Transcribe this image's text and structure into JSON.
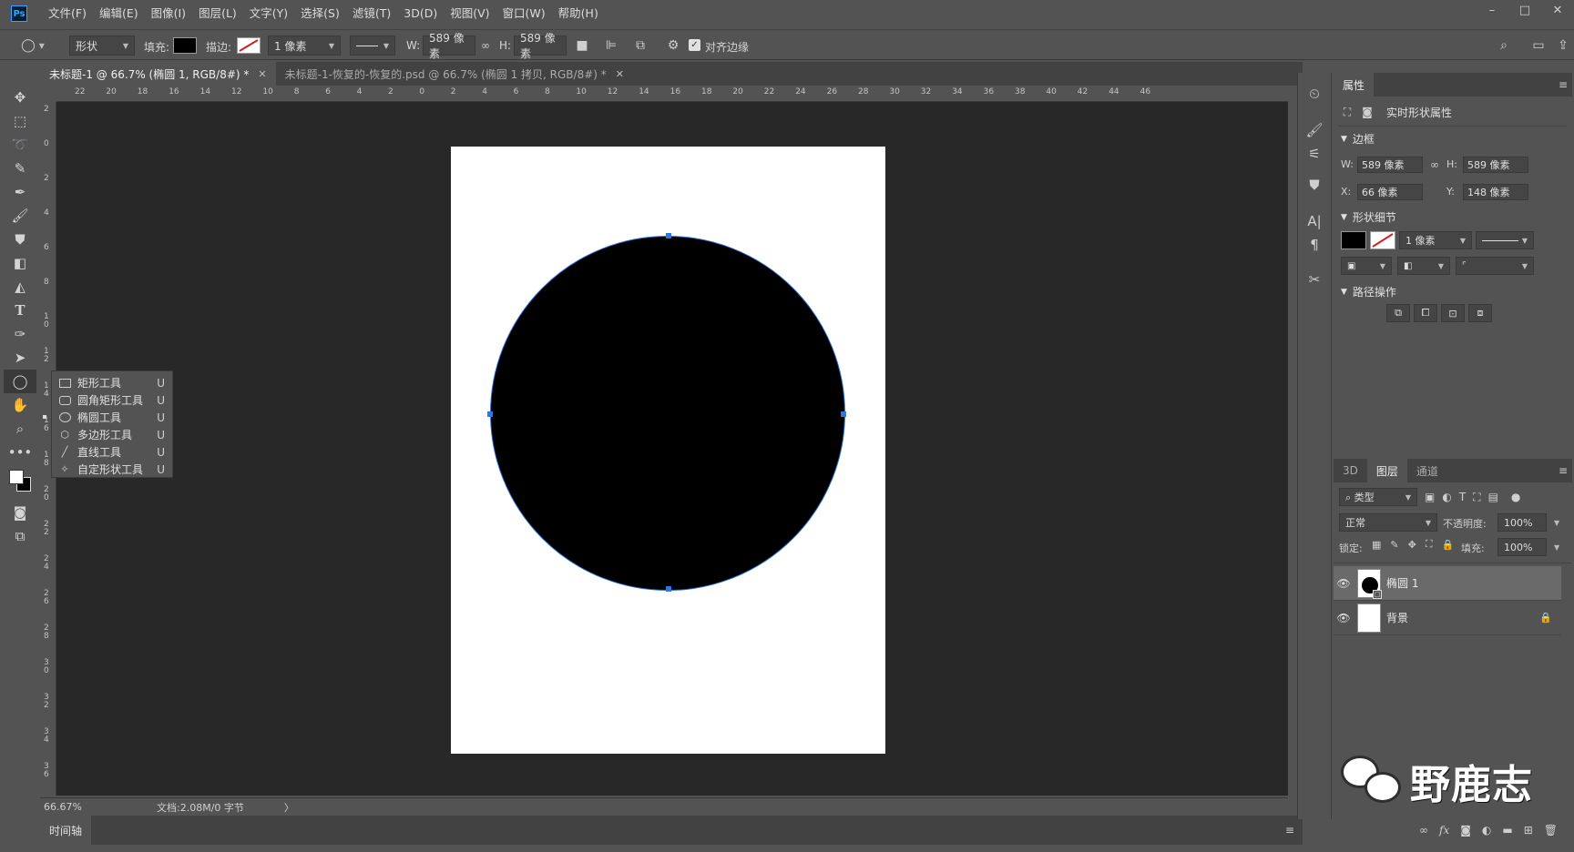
{
  "app": {
    "logo": "Ps"
  },
  "menu": [
    "文件(F)",
    "编辑(E)",
    "图像(I)",
    "图层(L)",
    "文字(Y)",
    "选择(S)",
    "滤镜(T)",
    "3D(D)",
    "视图(V)",
    "窗口(W)",
    "帮助(H)"
  ],
  "window_controls": {
    "minimize": "–",
    "maximize": "□",
    "close": "✕"
  },
  "options": {
    "mode": "形状",
    "fill_label": "填充:",
    "stroke_label": "描边:",
    "stroke_width": "1 像素",
    "w_label": "W:",
    "w_value": "589 像素",
    "h_label": "H:",
    "h_value": "589 像素",
    "align_edges": "对齐边缘"
  },
  "tabs": [
    {
      "label": "未标题-1 @ 66.7% (椭圆 1, RGB/8#) *",
      "active": true
    },
    {
      "label": "未标题-1-恢复的-恢复的.psd @ 66.7% (椭圆 1 拷贝, RGB/8#) *",
      "active": false
    }
  ],
  "tab_close": "✕",
  "ruler_top": [
    "22",
    "20",
    "18",
    "16",
    "14",
    "12",
    "10",
    "8",
    "6",
    "4",
    "2",
    "0",
    "2",
    "4",
    "6",
    "8",
    "10",
    "12",
    "14",
    "16",
    "18",
    "20",
    "22",
    "24",
    "26",
    "28",
    "30",
    "32",
    "34",
    "36",
    "38",
    "40",
    "42",
    "44",
    "46"
  ],
  "ruler_left": [
    "2",
    "0",
    "2",
    "4",
    "6",
    "8",
    "10",
    "12",
    "14",
    "16",
    "18",
    "20",
    "22",
    "24",
    "26",
    "28",
    "30",
    "32",
    "34",
    "36"
  ],
  "flyout": [
    {
      "label": "矩形工具",
      "key": "U",
      "icon": "rectangle-icon",
      "current": false
    },
    {
      "label": "圆角矩形工具",
      "key": "U",
      "icon": "rounded-rect-icon",
      "current": false
    },
    {
      "label": "椭圆工具",
      "key": "U",
      "icon": "ellipse-icon",
      "current": true
    },
    {
      "label": "多边形工具",
      "key": "U",
      "icon": "polygon-icon",
      "current": false
    },
    {
      "label": "直线工具",
      "key": "U",
      "icon": "line-icon",
      "current": false
    },
    {
      "label": "自定形状工具",
      "key": "U",
      "icon": "custom-shape-icon",
      "current": false
    }
  ],
  "status": {
    "zoom": "66.67%",
    "doc": "文档:2.08M/0 字节",
    "arrow": "〉"
  },
  "timeline": "时间轴",
  "properties": {
    "tab": "属性",
    "kind": "实时形状属性",
    "bounds_section": "边框",
    "w_label": "W:",
    "w_value": "589 像素",
    "h_label": "H:",
    "h_value": "589 像素",
    "x_label": "X:",
    "x_value": "66 像素",
    "y_label": "Y:",
    "y_value": "148 像素",
    "shape_section": "形状细节",
    "stroke_width": "1 像素",
    "path_section": "路径操作"
  },
  "layers_panel": {
    "tabs": [
      "3D",
      "图层",
      "通道"
    ],
    "active_tab": "图层",
    "filter": "类型",
    "blend_mode": "正常",
    "opacity_label": "不透明度:",
    "opacity": "100%",
    "lock_label": "锁定:",
    "fill_label": "填充:",
    "fill": "100%",
    "layers": [
      {
        "name": "椭圆 1",
        "selected": true,
        "locked": false
      },
      {
        "name": "背景",
        "selected": false,
        "locked": true
      }
    ]
  },
  "watermark": "野鹿志",
  "colors": {
    "accent": "#2b78e4",
    "canvas_bg": "#282828",
    "panel_bg": "#535353"
  }
}
